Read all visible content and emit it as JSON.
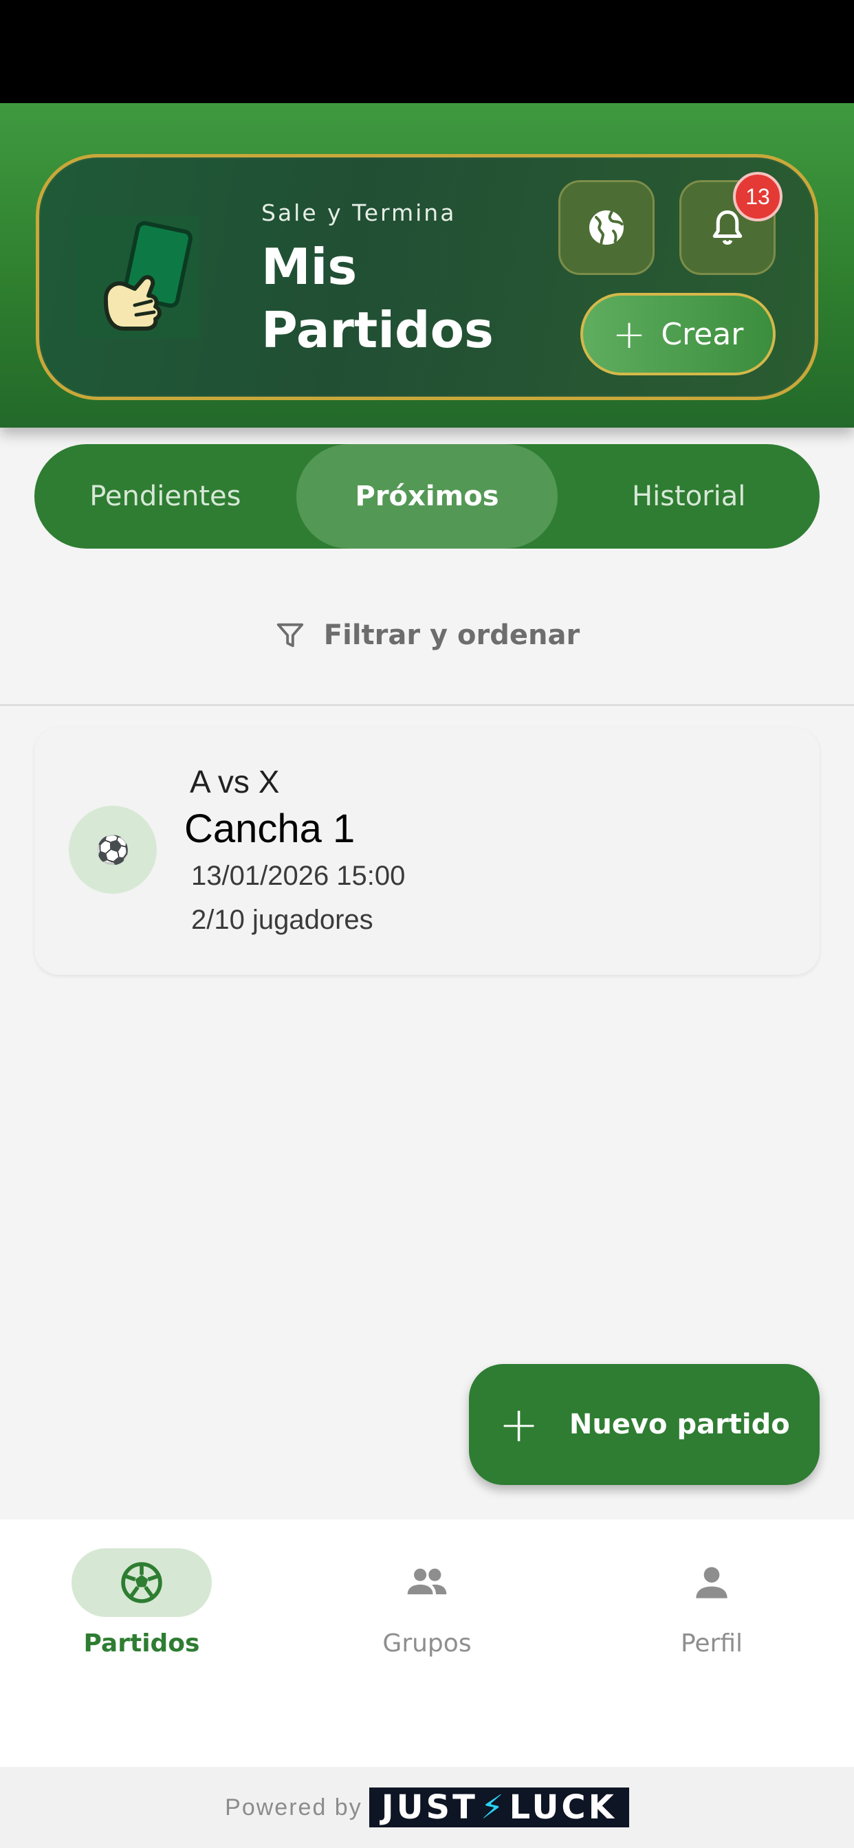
{
  "header": {
    "subtitle": "Sale y Termina",
    "title": "Mis Partidos",
    "notification_count": "13",
    "create_label": "Crear",
    "icons": {
      "globe": "globe-icon",
      "bell": "bell-icon",
      "logo": "green-card-hand-logo"
    }
  },
  "tabs": [
    {
      "label": "Pendientes",
      "active": false
    },
    {
      "label": "Próximos",
      "active": true
    },
    {
      "label": "Historial",
      "active": false
    }
  ],
  "filter": {
    "label": "Filtrar y ordenar",
    "icon": "filter-icon"
  },
  "matches": [
    {
      "title": "A vs X",
      "field": "Cancha 1",
      "datetime": "13/01/2026 15:00",
      "players": "2/10 jugadores",
      "icon": "⚽"
    }
  ],
  "fab": {
    "label": "Nuevo partido"
  },
  "bottom_nav": [
    {
      "label": "Partidos",
      "icon": "soccer-ball-icon",
      "active": true
    },
    {
      "label": "Grupos",
      "icon": "group-icon",
      "active": false
    },
    {
      "label": "Perfil",
      "icon": "person-icon",
      "active": false
    }
  ],
  "footer": {
    "powered_by": "Powered by",
    "brand_left": "JUST",
    "brand_right": "LUCK"
  },
  "colors": {
    "primary": "#2e7d32",
    "gold": "#c9a83a",
    "badge": "#e53935"
  }
}
